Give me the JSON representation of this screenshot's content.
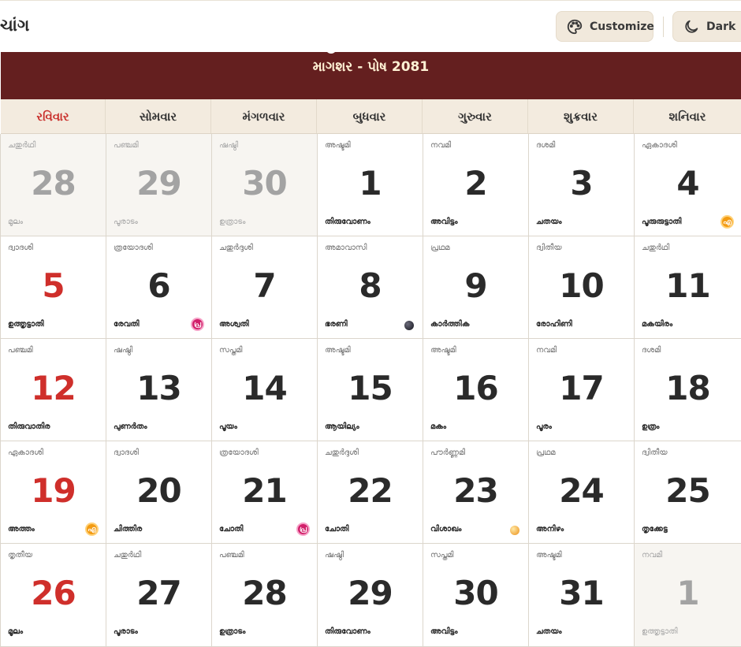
{
  "header": {
    "title": "ચાંગ",
    "customize_label": "Customize",
    "dark_label": "Dark"
  },
  "calendar": {
    "month_title": "માગશર - પોષ 2081",
    "weekdays": [
      "રવિવાર",
      "સોમવાર",
      "મંગળવાર",
      "બુધવાર",
      "ગુરુવાર",
      "શુક્રવાર",
      "શનિવાર"
    ],
    "days": [
      {
        "num": "28",
        "tithi": "ചതുർഥി",
        "nakshatra": "മൂലം",
        "faded": true
      },
      {
        "num": "29",
        "tithi": "പഞ്ചമി",
        "nakshatra": "പൂരാടം",
        "faded": true
      },
      {
        "num": "30",
        "tithi": "ഷഷ്ഠി",
        "nakshatra": "ഉത്രാടം",
        "faded": true
      },
      {
        "num": "1",
        "tithi": "അഷ്ടമി",
        "nakshatra": "തിരുവോണം"
      },
      {
        "num": "2",
        "tithi": "നവമി",
        "nakshatra": "അവിട്ടം"
      },
      {
        "num": "3",
        "tithi": "ദശമി",
        "nakshatra": "ചതയം"
      },
      {
        "num": "4",
        "tithi": "ഏകാദശി",
        "nakshatra": "പൂരുരുട്ടാതി",
        "badge": "എ",
        "badge_color": "orange"
      },
      {
        "num": "5",
        "tithi": "ദ്വാദശി",
        "nakshatra": "ഉത്തൃട്ടാതി"
      },
      {
        "num": "6",
        "tithi": "ത്രയോദശി",
        "nakshatra": "രേവതി",
        "badge": "പ്ര",
        "badge_color": "magenta"
      },
      {
        "num": "7",
        "tithi": "ചതുർദ്ദശി",
        "nakshatra": "അശ്വതി"
      },
      {
        "num": "8",
        "tithi": "അമാവാസി",
        "nakshatra": "ഭരണി",
        "moon": "new"
      },
      {
        "num": "9",
        "tithi": "പ്രഥമ",
        "nakshatra": "കാർത്തിക"
      },
      {
        "num": "10",
        "tithi": "ദ്വിതീയ",
        "nakshatra": "രോഹിണി"
      },
      {
        "num": "11",
        "tithi": "ചതുർഥി",
        "nakshatra": "മകയിരം"
      },
      {
        "num": "12",
        "tithi": "പഞ്ചമി",
        "nakshatra": "തിരുവാതിര"
      },
      {
        "num": "13",
        "tithi": "ഷഷ്ഠി",
        "nakshatra": "പുണർതം"
      },
      {
        "num": "14",
        "tithi": "സപ്തമി",
        "nakshatra": "പൂയം"
      },
      {
        "num": "15",
        "tithi": "അഷ്ടമി",
        "nakshatra": "ആയില്യം"
      },
      {
        "num": "16",
        "tithi": "അഷ്ടമി",
        "nakshatra": "മകം"
      },
      {
        "num": "17",
        "tithi": "നവമി",
        "nakshatra": "പൂരം"
      },
      {
        "num": "18",
        "tithi": "ദശമി",
        "nakshatra": "ഉത്രം"
      },
      {
        "num": "19",
        "tithi": "ഏകാദശി",
        "nakshatra": "അത്തം",
        "badge": "എ",
        "badge_color": "orange"
      },
      {
        "num": "20",
        "tithi": "ദ്വാദശി",
        "nakshatra": "ചിത്തിര"
      },
      {
        "num": "21",
        "tithi": "ത്രയോദശി",
        "nakshatra": "ചോതി",
        "badge": "പ്ര",
        "badge_color": "magenta"
      },
      {
        "num": "22",
        "tithi": "ചതുർദ്ദശി",
        "nakshatra": "ചോതി"
      },
      {
        "num": "23",
        "tithi": "പൗർണ്ണമി",
        "nakshatra": "വിശാഖം",
        "moon": "full"
      },
      {
        "num": "24",
        "tithi": "പ്രഥമ",
        "nakshatra": "അനിഴം"
      },
      {
        "num": "25",
        "tithi": "ദ്വിതീയ",
        "nakshatra": "തൃക്കേട്ട"
      },
      {
        "num": "26",
        "tithi": "തൃതീയ",
        "nakshatra": "മൂലം"
      },
      {
        "num": "27",
        "tithi": "ചതുർഥി",
        "nakshatra": "പൂരാടം"
      },
      {
        "num": "28",
        "tithi": "പഞ്ചമി",
        "nakshatra": "ഉത്രാടം"
      },
      {
        "num": "29",
        "tithi": "ഷഷ്ഠി",
        "nakshatra": "തിരുവോണം"
      },
      {
        "num": "30",
        "tithi": "സപ്തമി",
        "nakshatra": "അവിട്ടം"
      },
      {
        "num": "31",
        "tithi": "അഷ്ടമി",
        "nakshatra": "ചതയം"
      },
      {
        "num": "1",
        "tithi": "നവമി",
        "nakshatra": "ഉത്തൃട്ടാതി",
        "faded": true
      }
    ]
  },
  "colors": {
    "month_bar": "#641f1f",
    "sunday_red": "#cf2f2b",
    "weekday_bg": "#f3ebdf",
    "button_bg": "#f1e9dc"
  },
  "icons": {
    "customize": "palette-icon",
    "dark": "moon-icon"
  }
}
